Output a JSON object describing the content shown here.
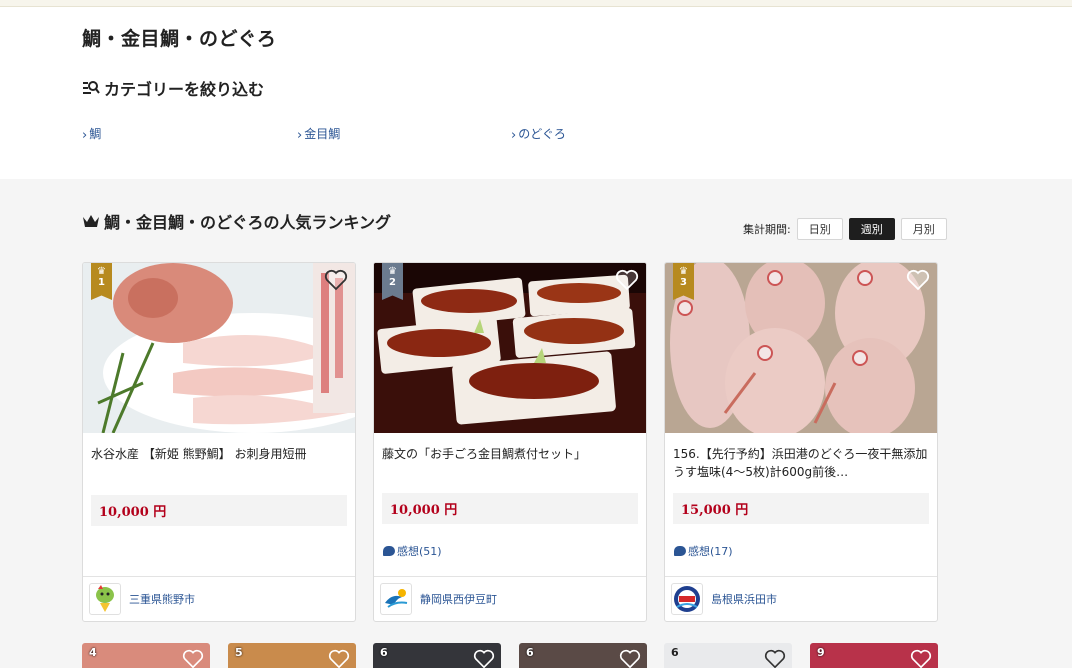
{
  "page_title": "鯛・金目鯛・のどぐろ",
  "filter": {
    "heading": "カテゴリーを絞り込む",
    "categories": [
      "鯛",
      "金目鯛",
      "のどぐろ"
    ]
  },
  "ranking": {
    "heading": "鯛・金目鯛・のどぐろの人気ランキング",
    "period_label": "集計期間:",
    "periods": [
      "日別",
      "週別",
      "月別"
    ],
    "active_period": "週別",
    "items": [
      {
        "rank": "1",
        "name": "水谷水産 【新姫 熊野鯛】 お刺身用短冊",
        "price": "10,000 円",
        "review": "",
        "municipality": "三重県熊野市",
        "logo_icon": "kumano-mascot-icon"
      },
      {
        "rank": "2",
        "name": "藤文の「お手ごろ金目鯛煮付セット」",
        "price": "10,000 円",
        "review": "感想(51)",
        "municipality": "静岡県西伊豆町",
        "logo_icon": "wave-logo-icon"
      },
      {
        "rank": "3",
        "name": "156.【先行予約】浜田港のどぐろ一夜干無添加うす塩味(4～5枚)計600g前後…",
        "price": "15,000 円",
        "review": "感想(17)",
        "municipality": "島根県浜田市",
        "logo_icon": "hamada-port-logo-icon"
      }
    ],
    "more_ranks": [
      "4",
      "5",
      "6",
      "6",
      "6",
      "9"
    ]
  },
  "colors": {
    "link": "#2b5594",
    "price": "#b3001b",
    "gold_badge": "#b78a1f",
    "silver_badge": "#6b7b8f",
    "active_period": "#1e1e1e"
  }
}
